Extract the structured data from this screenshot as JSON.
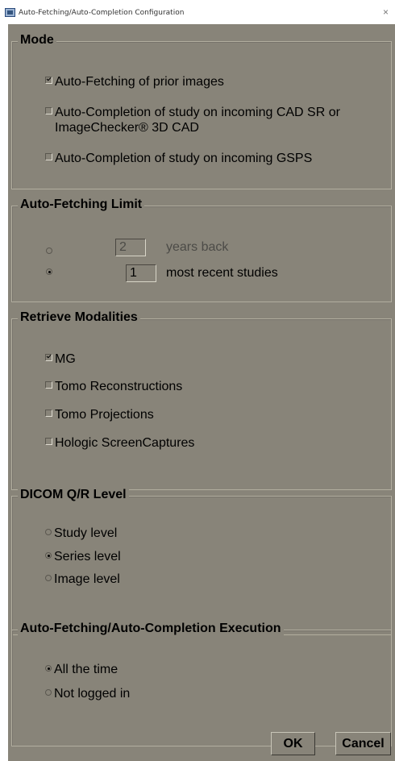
{
  "window": {
    "title": "Auto-Fetching/Auto-Completion Configuration",
    "close_glyph": "×",
    "app_icon": "app-window-icon"
  },
  "mode": {
    "title": "Mode",
    "options": [
      {
        "label": "Auto-Fetching of prior images",
        "checked": true
      },
      {
        "label_line1": "Auto-Completion of study on incoming CAD SR or",
        "label_line2": "ImageChecker® 3D CAD",
        "checked": false
      },
      {
        "label": "Auto-Completion of study on incoming GSPS",
        "checked": false
      }
    ]
  },
  "limit": {
    "title": "Auto-Fetching Limit",
    "years_value": "2",
    "years_label": "years back",
    "recent_value": "1",
    "recent_label": "most recent studies",
    "selected": "recent"
  },
  "modalities": {
    "title": "Retrieve Modalities",
    "options": [
      {
        "label": "MG",
        "checked": true
      },
      {
        "label": "Tomo Reconstructions",
        "checked": false
      },
      {
        "label": "Tomo Projections",
        "checked": false
      },
      {
        "label": "Hologic ScreenCaptures",
        "checked": false
      }
    ]
  },
  "qr_level": {
    "title": "DICOM Q/R Level",
    "options": [
      {
        "label": "Study level",
        "selected": false
      },
      {
        "label": "Series level",
        "selected": true
      },
      {
        "label": "Image level",
        "selected": false
      }
    ]
  },
  "execution": {
    "title": "Auto-Fetching/Auto-Completion Execution",
    "options": [
      {
        "label": "All the time",
        "selected": true
      },
      {
        "label": "Not logged in",
        "selected": false
      }
    ]
  },
  "buttons": {
    "ok": "OK",
    "cancel": "Cancel"
  }
}
